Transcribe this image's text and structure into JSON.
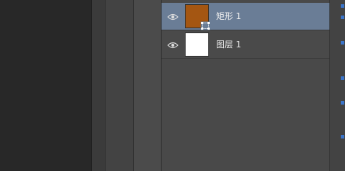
{
  "layers_panel": {
    "layers": [
      {
        "name": "矩形 1",
        "selected": true,
        "visible": true,
        "thumbnail_color": "#a45612",
        "type": "shape",
        "icon": "vector-mask-icon"
      },
      {
        "name": "图层 1",
        "selected": false,
        "visible": true,
        "thumbnail_color": "#ffffff",
        "type": "pixel"
      }
    ],
    "colors": {
      "selected_row": "#6a7d96",
      "panel_bg": "#494949",
      "workspace_bg": "#282828",
      "accent": "#3a74c9"
    }
  }
}
